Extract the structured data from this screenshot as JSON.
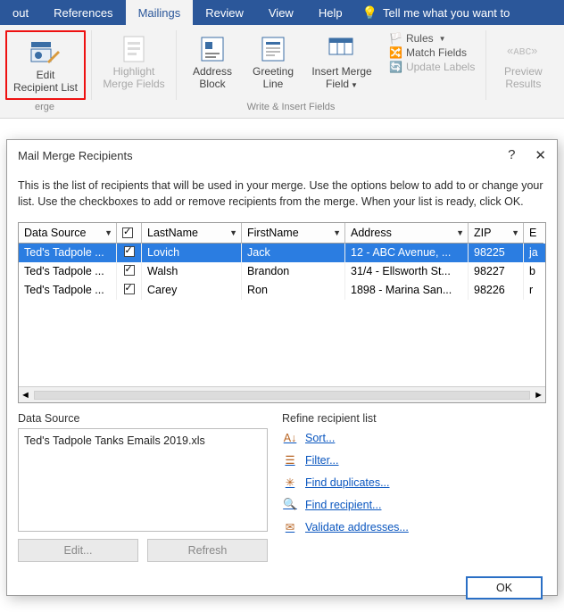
{
  "tabs": {
    "items": [
      "out",
      "References",
      "Mailings",
      "Review",
      "View",
      "Help"
    ],
    "active_index": 2,
    "tell_me": "Tell me what you want to"
  },
  "ribbon": {
    "edit_recipient": {
      "line1": "Edit",
      "line2": "Recipient List"
    },
    "highlight": {
      "line1": "Highlight",
      "line2": "Merge Fields"
    },
    "address": {
      "line1": "Address",
      "line2": "Block"
    },
    "greeting": {
      "line1": "Greeting",
      "line2": "Line"
    },
    "insert": {
      "line1": "Insert Merge",
      "line2": "Field"
    },
    "side": {
      "rules": "Rules",
      "match": "Match Fields",
      "update": "Update Labels"
    },
    "preview": {
      "line1": "Preview",
      "line2": "Results"
    },
    "caption_left": "erge",
    "caption_write": "Write & Insert Fields"
  },
  "dialog": {
    "title": "Mail Merge Recipients",
    "help": "?",
    "close": "✕",
    "intro": "This is the list of recipients that will be used in your merge.  Use the options below to add to or change your list.  Use the checkboxes to add or remove recipients from the merge.  When your list is ready, click OK.",
    "cols": {
      "ds": "Data Source",
      "ln": "LastName",
      "fn": "FirstName",
      "ad": "Address",
      "zip": "ZIP",
      "em": "E"
    },
    "rows": [
      {
        "ds": "Ted's Tadpole ...",
        "ln": "Lovich",
        "fn": "Jack",
        "ad": "12 - ABC Avenue, ...",
        "zip": "98225",
        "em": "ja"
      },
      {
        "ds": "Ted's Tadpole ...",
        "ln": "Walsh",
        "fn": "Brandon",
        "ad": "31/4 - Ellsworth St...",
        "zip": "98227",
        "em": "b"
      },
      {
        "ds": "Ted's Tadpole ...",
        "ln": "Carey",
        "fn": "Ron",
        "ad": "1898 - Marina San...",
        "zip": "98226",
        "em": "r"
      }
    ],
    "data_source": {
      "title": "Data Source",
      "file": "Ted's Tadpole Tanks Emails 2019.xls",
      "edit": "Edit...",
      "refresh": "Refresh"
    },
    "refine": {
      "title": "Refine recipient list",
      "sort": "Sort...",
      "filter": "Filter...",
      "dup": "Find duplicates...",
      "find": "Find recipient...",
      "validate": "Validate addresses..."
    },
    "ok": "OK"
  }
}
